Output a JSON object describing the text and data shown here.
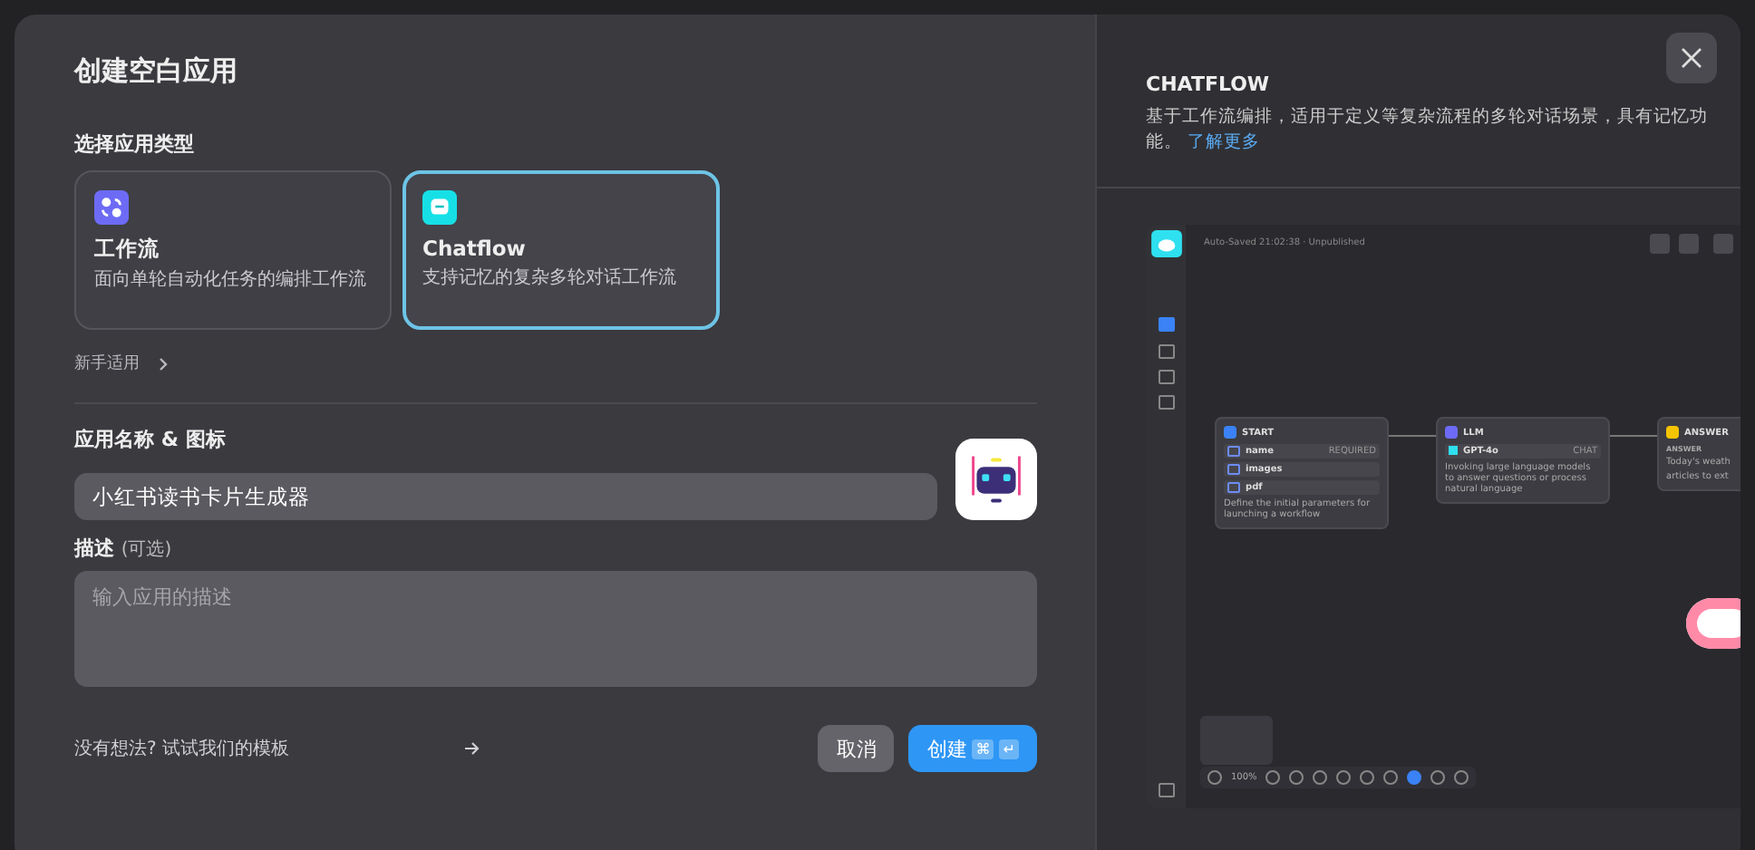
{
  "dialog": {
    "title": "创建空白应用",
    "section_label": "选择应用类型",
    "app_types": [
      {
        "kind": "workflow",
        "name": "工作流",
        "description": "面向单轮自动化任务的编排工作流",
        "selected": false
      },
      {
        "kind": "chatflow",
        "name": "Chatflow",
        "description": "支持记忆的复杂多轮对话工作流",
        "selected": true
      }
    ],
    "beginner_link": "新手适用",
    "name_label": "应用名称 & 图标",
    "name_value": "小红书读书卡片生成器",
    "description_label": "描述",
    "description_optional": "(可选)",
    "description_placeholder": "输入应用的描述",
    "template_link": "没有想法? 试试我们的模板",
    "cancel_button": "取消",
    "create_button": "创建",
    "shortcut_keys": [
      "⌘",
      "↵"
    ]
  },
  "preview": {
    "title": "CHATFLOW",
    "description": "基于工作流编排，适用于定义等复杂流程的多轮对话场景，具有记忆功能。",
    "learn_more": "了解更多",
    "screenshot": {
      "status": "Auto-Saved 21:02:38 · Unpublished",
      "start_node": {
        "title": "START",
        "variables": [
          {
            "name": "name",
            "badge": "REQUIRED"
          },
          {
            "name": "images"
          },
          {
            "name": "pdf"
          }
        ],
        "description": "Define the initial parameters for launching a workflow"
      },
      "llm_node": {
        "title": "LLM",
        "model": "GPT-4o",
        "mode": "CHAT",
        "description": "Invoking large language models to answer questions or process natural language"
      },
      "answer_node": {
        "title": "ANSWER",
        "label": "ANSWER",
        "lines": [
          "Today's weath",
          "articles to ext"
        ]
      },
      "zoom": "100%"
    }
  }
}
